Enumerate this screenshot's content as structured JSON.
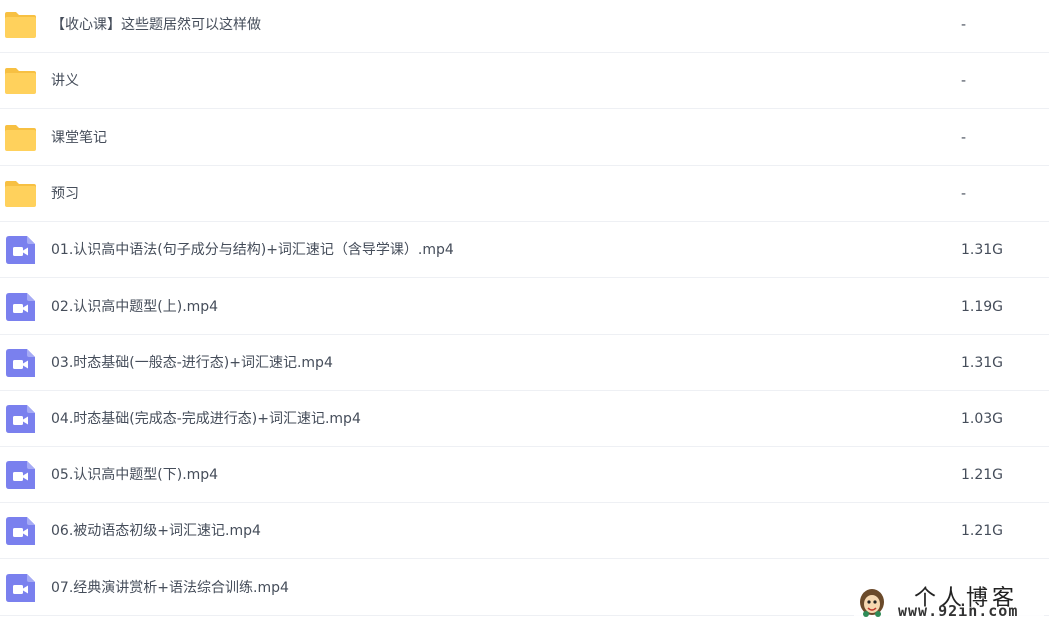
{
  "colors": {
    "folder": "#ffd15c",
    "folder_tab": "#f7c042",
    "video_icon": "#7a80ee",
    "divider": "#eef0f4",
    "text": "#454d5a"
  },
  "files": [
    {
      "name": "【收心课】这些题居然可以这样做",
      "size": "-",
      "icon": "folder-icon"
    },
    {
      "name": "讲义",
      "size": "-",
      "icon": "folder-icon"
    },
    {
      "name": "课堂笔记",
      "size": "-",
      "icon": "folder-icon"
    },
    {
      "name": "预习",
      "size": "-",
      "icon": "folder-icon"
    },
    {
      "name": "01.认识高中语法(句子成分与结构)+词汇速记（含导学课）.mp4",
      "size": "1.31G",
      "icon": "video-file-icon"
    },
    {
      "name": "02.认识高中题型(上).mp4",
      "size": "1.19G",
      "icon": "video-file-icon"
    },
    {
      "name": "03.时态基础(一般态-进行态)+词汇速记.mp4",
      "size": "1.31G",
      "icon": "video-file-icon"
    },
    {
      "name": "04.时态基础(完成态-完成进行态)+词汇速记.mp4",
      "size": "1.03G",
      "icon": "video-file-icon"
    },
    {
      "name": "05.认识高中题型(下).mp4",
      "size": "1.21G",
      "icon": "video-file-icon"
    },
    {
      "name": "06.被动语态初级+词汇速记.mp4",
      "size": "1.21G",
      "icon": "video-file-icon"
    },
    {
      "name": "07.经典演讲赏析+语法综合训练.mp4",
      "size": "",
      "icon": "video-file-icon"
    }
  ],
  "watermark": {
    "title": "个人博客",
    "url": "www.92in.com"
  }
}
